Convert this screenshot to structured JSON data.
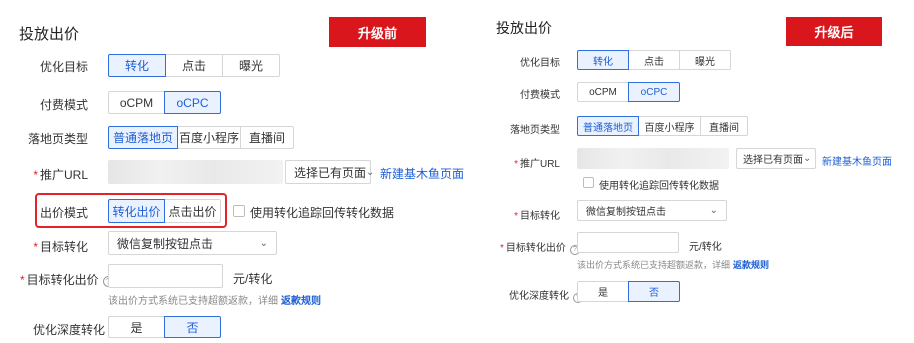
{
  "left": {
    "title": "投放出价",
    "badge": "升级前",
    "opt_goal": {
      "label": "优化目标",
      "options": [
        "转化",
        "点击",
        "曝光"
      ],
      "selected": "转化"
    },
    "pay_mode": {
      "label": "付费模式",
      "options": [
        "oCPM",
        "oCPC"
      ],
      "selected": "oCPC"
    },
    "landing_type": {
      "label": "落地页类型",
      "options": [
        "普通落地页",
        "百度小程序",
        "直播间"
      ],
      "selected": "普通落地页"
    },
    "promo_url": {
      "label": "推广URL",
      "value": "",
      "select_value": "选择已有页面",
      "link": "新建基木鱼页面"
    },
    "bid_mode": {
      "label": "出价模式",
      "options": [
        "转化出价",
        "点击出价"
      ],
      "selected": "转化出价"
    },
    "tracking_checkbox": "使用转化追踪回传转化数据",
    "target_conv": {
      "label": "目标转化",
      "value": "微信复制按钮点击"
    },
    "target_bid": {
      "label": "目标转化出价",
      "value": "",
      "unit": "元/转化",
      "hint": "该出价方式系统已支持超额返款，详细",
      "hint_link": "返款规则"
    },
    "deep_conv": {
      "label": "优化深度转化",
      "options": [
        "是",
        "否"
      ],
      "selected": "否"
    }
  },
  "right": {
    "title": "投放出价",
    "badge": "升级后",
    "opt_goal": {
      "label": "优化目标",
      "options": [
        "转化",
        "点击",
        "曝光"
      ],
      "selected": "转化"
    },
    "pay_mode": {
      "label": "付费模式",
      "options": [
        "oCPM",
        "oCPC"
      ],
      "selected": "oCPC"
    },
    "landing_type": {
      "label": "落地页类型",
      "options": [
        "普通落地页",
        "百度小程序",
        "直播间"
      ],
      "selected": "普通落地页"
    },
    "promo_url": {
      "label": "推广URL",
      "value": "",
      "select_value": "选择已有页面",
      "link": "新建基木鱼页面"
    },
    "tracking_checkbox": "使用转化追踪回传转化数据",
    "target_conv": {
      "label": "目标转化",
      "value": "微信复制按钮点击"
    },
    "target_bid": {
      "label": "目标转化出价",
      "value": "",
      "unit": "元/转化",
      "hint": "该出价方式系统已支持超额返款，详细",
      "hint_link": "返款规则"
    },
    "deep_conv": {
      "label": "优化深度转化",
      "options": [
        "是",
        "否"
      ],
      "selected": "否"
    }
  },
  "colors": {
    "accent": "#2f6fe0",
    "badge": "#d8161c",
    "highlight": "#e0242b"
  },
  "icons": {
    "question": "question-circle-icon",
    "chevron": "chevron-down-icon"
  }
}
